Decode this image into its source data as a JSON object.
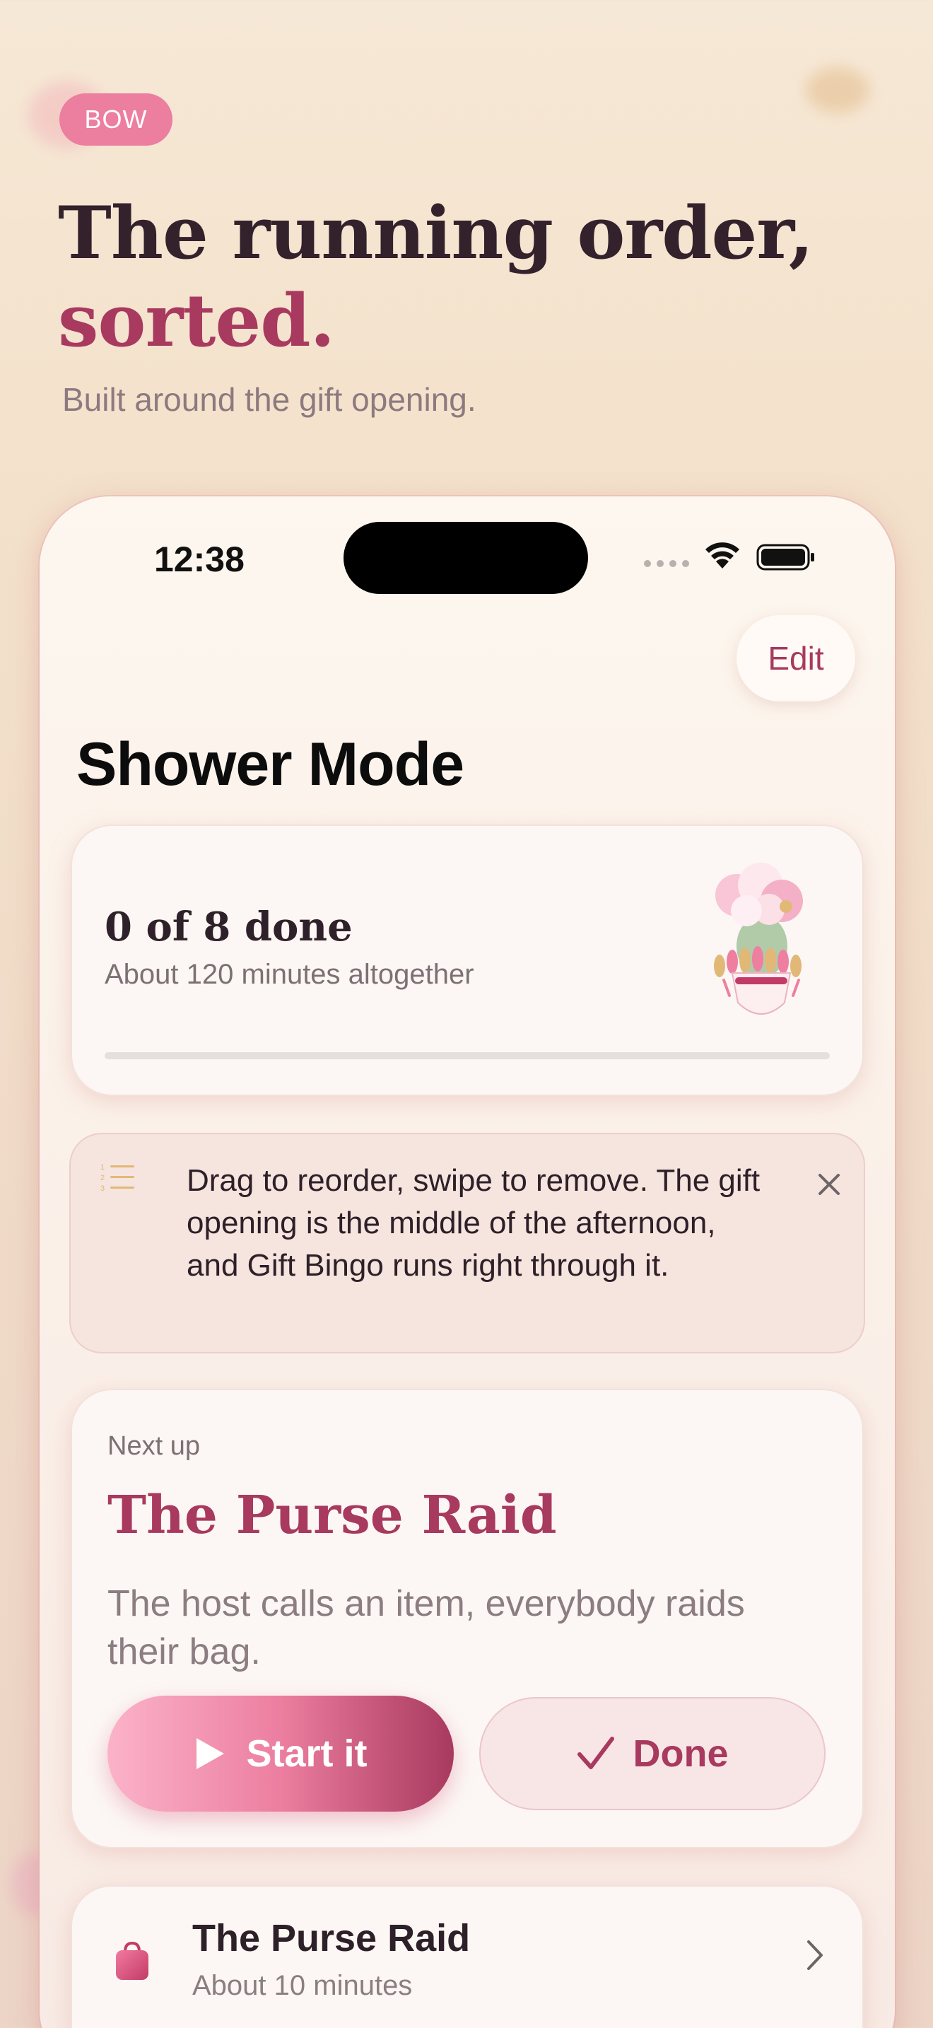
{
  "promo": {
    "badge": "BOW",
    "title_line1": "The running order,",
    "title_line2": "sorted.",
    "subtitle": "Built around the gift opening."
  },
  "status_bar": {
    "time": "12:38"
  },
  "nav": {
    "edit_label": "Edit",
    "title": "Shower Mode"
  },
  "progress": {
    "done_text": "0 of 8 done",
    "duration_text": "About 120 minutes altogether",
    "completed": 0,
    "total": 8,
    "fraction": 0
  },
  "tip": {
    "text": "Drag to reorder, swipe to remove. The gift opening is the middle of the afternoon, and Gift Bingo runs right through it.",
    "icon": "numbered-list-icon",
    "close_icon": "close-icon"
  },
  "next_up": {
    "label": "Next up",
    "title": "The Purse Raid",
    "description": "The host calls an item, everybody raids their bag.",
    "start_label": "Start it",
    "done_label": "Done"
  },
  "schedule": {
    "items": [
      {
        "title": "The Purse Raid",
        "duration": "About 10 minutes",
        "icon": "purse-icon"
      }
    ]
  },
  "colors": {
    "accent": "#a8395f",
    "pink": "#ec7ea0",
    "background": "#f4e2cc"
  }
}
